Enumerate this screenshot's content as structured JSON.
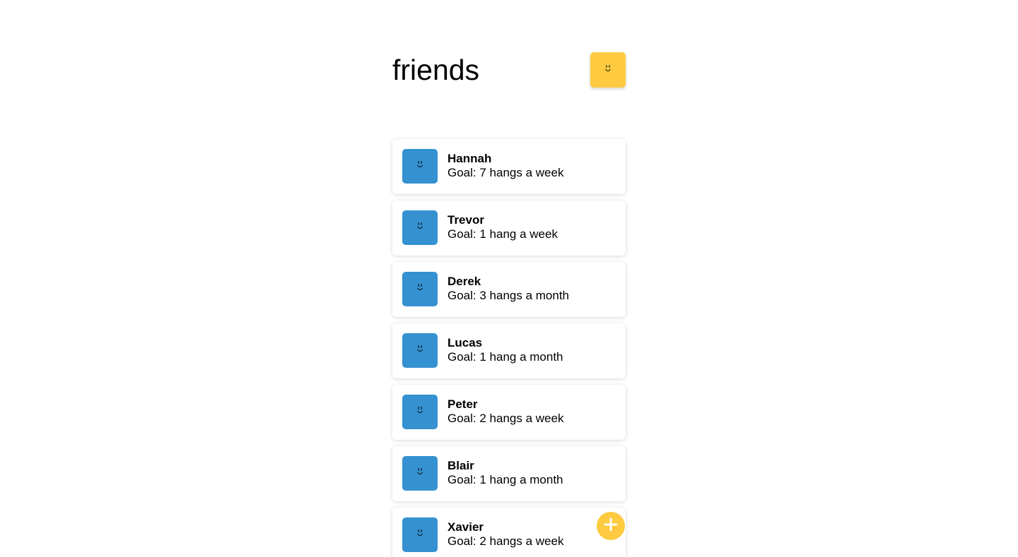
{
  "header": {
    "title": "friends",
    "profile_icon": "smiley-face-icon"
  },
  "friends": [
    {
      "name": "Hannah",
      "goal": "Goal: 7 hangs a week"
    },
    {
      "name": "Trevor",
      "goal": "Goal: 1 hang a week"
    },
    {
      "name": "Derek",
      "goal": "Goal: 3 hangs a month"
    },
    {
      "name": "Lucas",
      "goal": "Goal: 1 hang a month"
    },
    {
      "name": "Peter",
      "goal": "Goal: 2 hangs a week"
    },
    {
      "name": "Blair",
      "goal": "Goal: 1 hang a month"
    },
    {
      "name": "Xavier",
      "goal": "Goal: 2 hangs a week"
    }
  ],
  "avatar_icon": "smiley-face-icon",
  "fab": {
    "icon": "plus-icon"
  },
  "colors": {
    "accent_yellow": "#fdca40",
    "avatar_blue": "#3591d0"
  }
}
